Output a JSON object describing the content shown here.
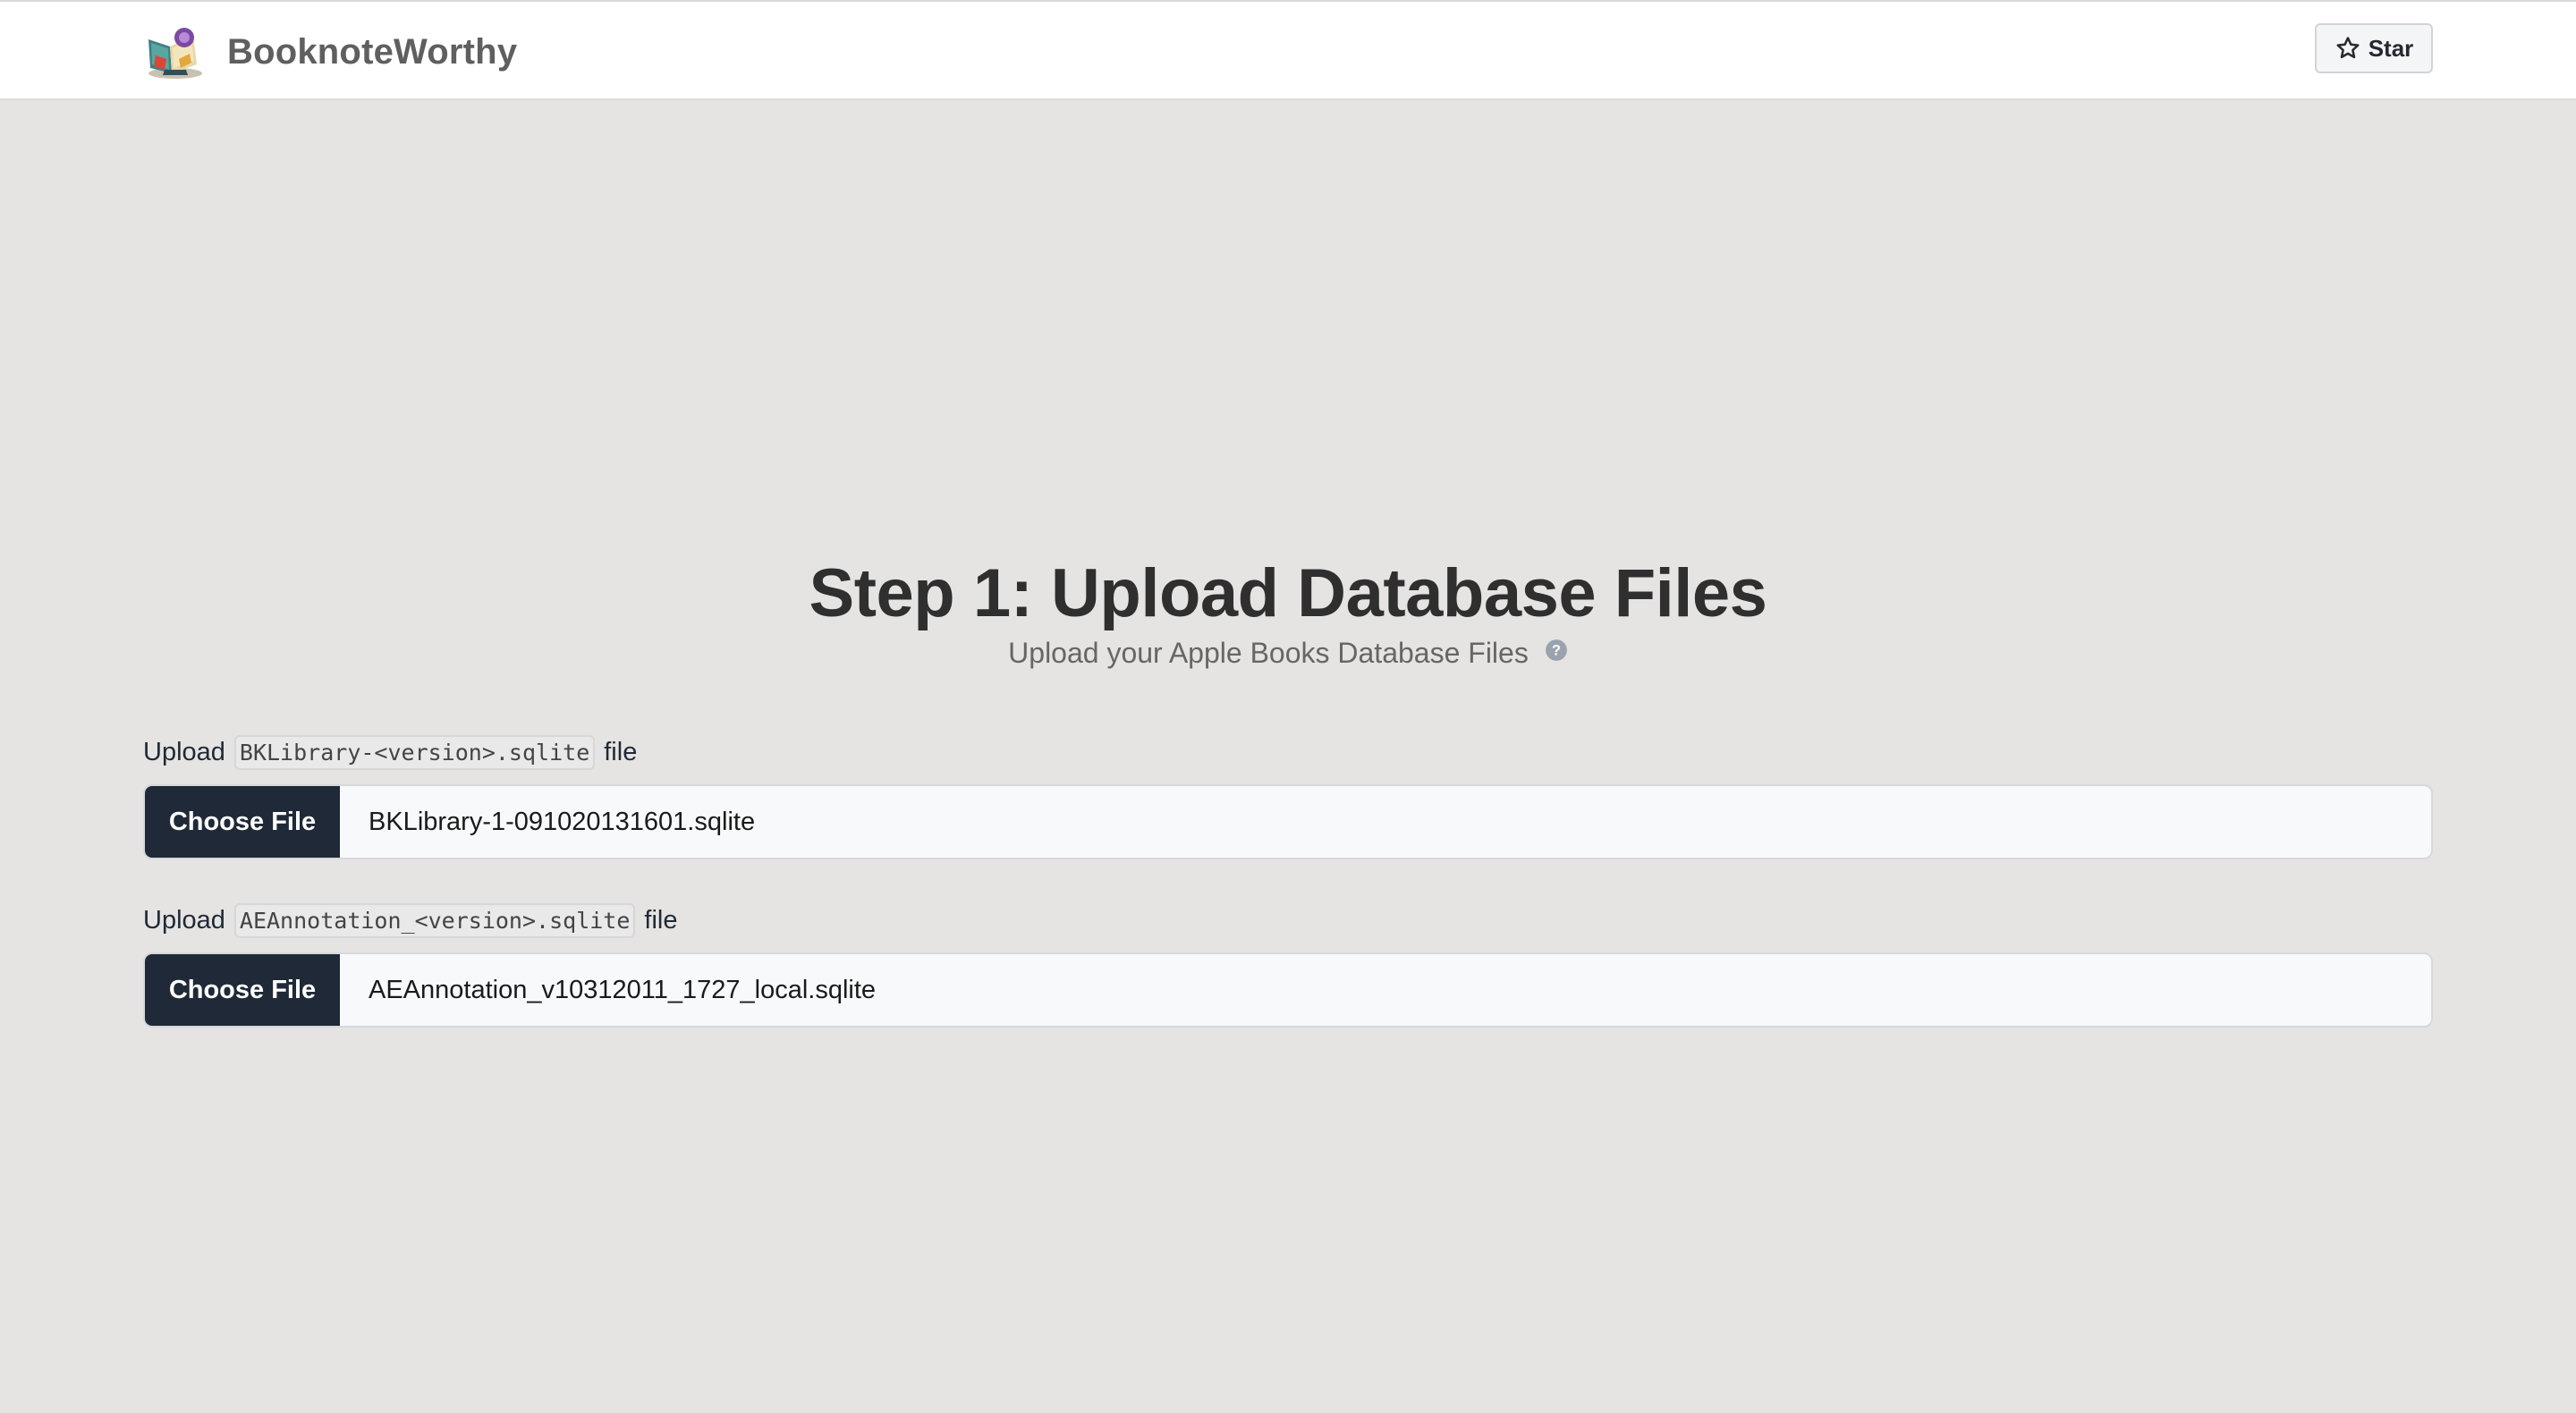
{
  "header": {
    "brand_name": "BooknoteWorthy",
    "star_label": "Star"
  },
  "hero": {
    "title": "Step 1: Upload Database Files",
    "subtitle": "Upload your Apple Books Database Files"
  },
  "uploads": [
    {
      "label_prefix": "Upload",
      "label_code": "BKLibrary-<version>.sqlite",
      "label_suffix": "file",
      "button_label": "Choose File",
      "file_name": "BKLibrary-1-091020131601.sqlite"
    },
    {
      "label_prefix": "Upload",
      "label_code": "AEAnnotation_<version>.sqlite",
      "label_suffix": "file",
      "button_label": "Choose File",
      "file_name": "AEAnnotation_v10312011_1727_local.sqlite"
    }
  ],
  "icons": {
    "logo": "book-logo-icon",
    "star": "star-outline-icon",
    "help": "question-circle-icon"
  },
  "colors": {
    "page_background": "#e5e4e2",
    "header_background": "#ffffff",
    "button_dark": "#1f2937",
    "brand_text": "#5f5f5f"
  }
}
